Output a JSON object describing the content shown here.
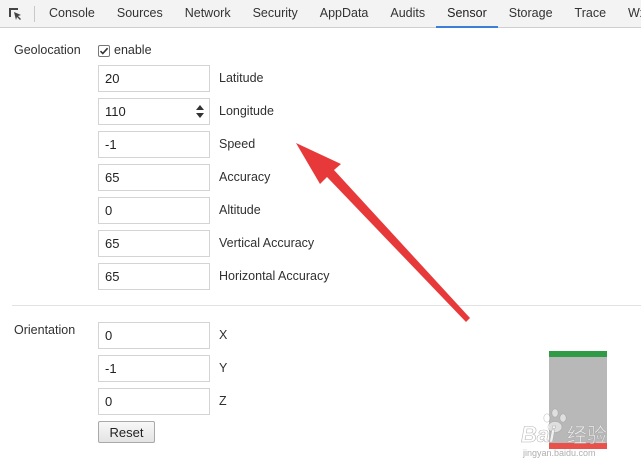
{
  "tabs": [
    "Console",
    "Sources",
    "Network",
    "Security",
    "AppData",
    "Audits",
    "Sensor",
    "Storage",
    "Trace",
    "Wxm"
  ],
  "active_tab": "Sensor",
  "geolocation": {
    "section_label": "Geolocation",
    "enable_label": "enable",
    "enabled": true,
    "fields": [
      {
        "label": "Latitude",
        "value": "20"
      },
      {
        "label": "Longitude",
        "value": "110"
      },
      {
        "label": "Speed",
        "value": "-1"
      },
      {
        "label": "Accuracy",
        "value": "65"
      },
      {
        "label": "Altitude",
        "value": "0"
      },
      {
        "label": "Vertical Accuracy",
        "value": "65"
      },
      {
        "label": "Horizontal Accuracy",
        "value": "65"
      }
    ]
  },
  "orientation": {
    "section_label": "Orientation",
    "fields": [
      {
        "label": "X",
        "value": "0"
      },
      {
        "label": "Y",
        "value": "-1"
      },
      {
        "label": "Z",
        "value": "0"
      }
    ],
    "reset_label": "Reset"
  },
  "colors": {
    "active_tab_underline": "#3b7fd8",
    "arrow": "#e8393a",
    "device_top": "#2f9b46",
    "device_bottom": "#e8524a",
    "device_body": "#b8b8b8"
  },
  "watermark": {
    "brand": "Bai",
    "brand_suffix": "经验",
    "url": "jingyan.baidu.com"
  }
}
